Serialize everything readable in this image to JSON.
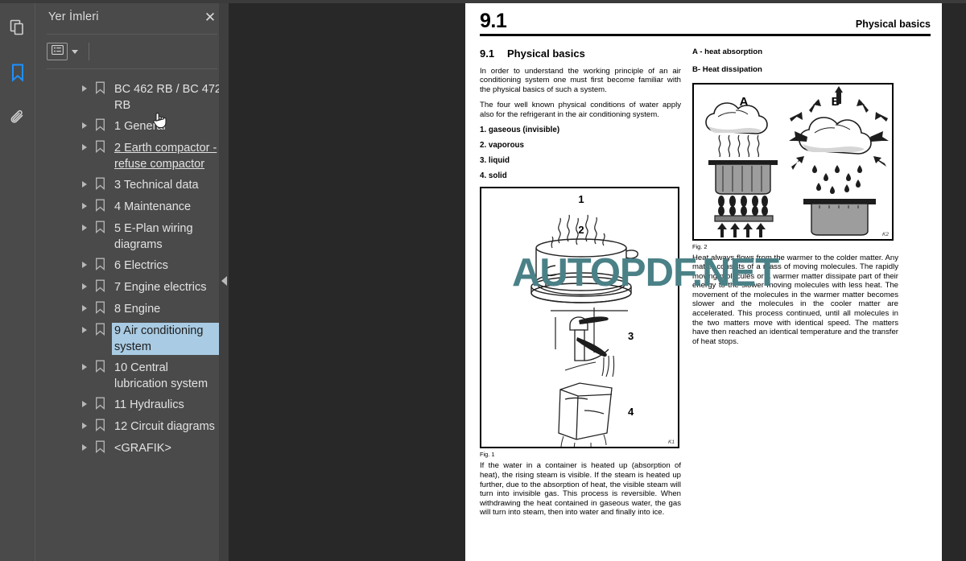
{
  "app": {
    "background_color": "#282828",
    "panel_color": "#4a4a4a",
    "accent_color": "#1a8cff",
    "selection_color": "#a9cbe3"
  },
  "rail": {
    "items": [
      {
        "icon": "pages-thumbnails-icon",
        "name": "thumbnails",
        "active": false
      },
      {
        "icon": "bookmark-icon",
        "name": "bookmarks",
        "active": true
      },
      {
        "icon": "paperclip-icon",
        "name": "attachments",
        "active": false
      }
    ]
  },
  "sidebar": {
    "title": "Yer İmleri",
    "close_label": "✕",
    "toolbar": {
      "list_options_label": "list-options",
      "caret_label": "dropdown"
    },
    "items": [
      {
        "label": "BC 462 RB / BC 472 RB",
        "state": "normal"
      },
      {
        "label": "1 General",
        "state": "normal"
      },
      {
        "label": "2 Earth compactor - refuse compactor",
        "state": "hovered"
      },
      {
        "label": "3 Technical data",
        "state": "normal"
      },
      {
        "label": "4 Maintenance",
        "state": "normal"
      },
      {
        "label": "5 E-Plan wiring diagrams",
        "state": "normal"
      },
      {
        "label": "6 Electrics",
        "state": "normal"
      },
      {
        "label": "7 Engine electrics",
        "state": "normal"
      },
      {
        "label": "8 Engine",
        "state": "normal"
      },
      {
        "label": "9 Air conditioning system",
        "state": "selected"
      },
      {
        "label": "10 Central lubrication system",
        "state": "normal"
      },
      {
        "label": "11 Hydraulics",
        "state": "normal"
      },
      {
        "label": "12 Circuit diagrams",
        "state": "normal"
      },
      {
        "label": "<GRAFIK>",
        "state": "normal"
      }
    ]
  },
  "watermark": {
    "text": "AUTOPDF.NET",
    "color": "#4a8187"
  },
  "document": {
    "header": {
      "number": "9.1",
      "title": "Physical basics"
    },
    "left_column": {
      "section_number": "9.1",
      "section_title": "Physical basics",
      "paragraph_1": "In order to understand the working principle of an air conditioning system one must first become familiar with the physical basics of such a system.",
      "paragraph_2": "The four well known physical conditions of water apply also for the refrigerant in the air conditioning system.",
      "list": [
        "1. gaseous (invisible)",
        "2. vaporous",
        "3. liquid",
        "4. solid"
      ],
      "figure": {
        "caption": "Fig. 1",
        "code": "K1",
        "callouts": [
          "1",
          "2",
          "3",
          "4"
        ],
        "description": "pot with rising steam, water tap running, ice cube"
      },
      "paragraph_3": "If the water in a container is heated up (absorption of heat), the rising steam is visible. If the steam is heated up further, due to the absorption of heat, the visible steam will turn into invisible gas. This process is reversible. When withdrawing the heat contained in gaseous water, the gas will turn into steam, then into water and finally into ice."
    },
    "right_column": {
      "legend": [
        "A - heat absorption",
        "B- Heat dissipation"
      ],
      "figure": {
        "caption": "Fig. 2",
        "code": "K2",
        "callouts": [
          "A",
          "B"
        ],
        "description": "A: cloud over heated pot absorbing heat; B: cloud dissipating heat with arrows, raining into pot"
      },
      "paragraph_1": "Heat always flows from the warmer to the colder matter. Any matter consists of a mass of moving molecules. The rapidly moving molecules or a warmer matter dissipate part of their energy to the slower moving molecules with less heat. The movement of the molecules in the warmer matter becomes slower and the molecules in the cooler matter are accelerated. This process continued, until all molecules in the two matters move with identical speed. The matters have then reached an identical temperature and the transfer of heat stops."
    }
  }
}
